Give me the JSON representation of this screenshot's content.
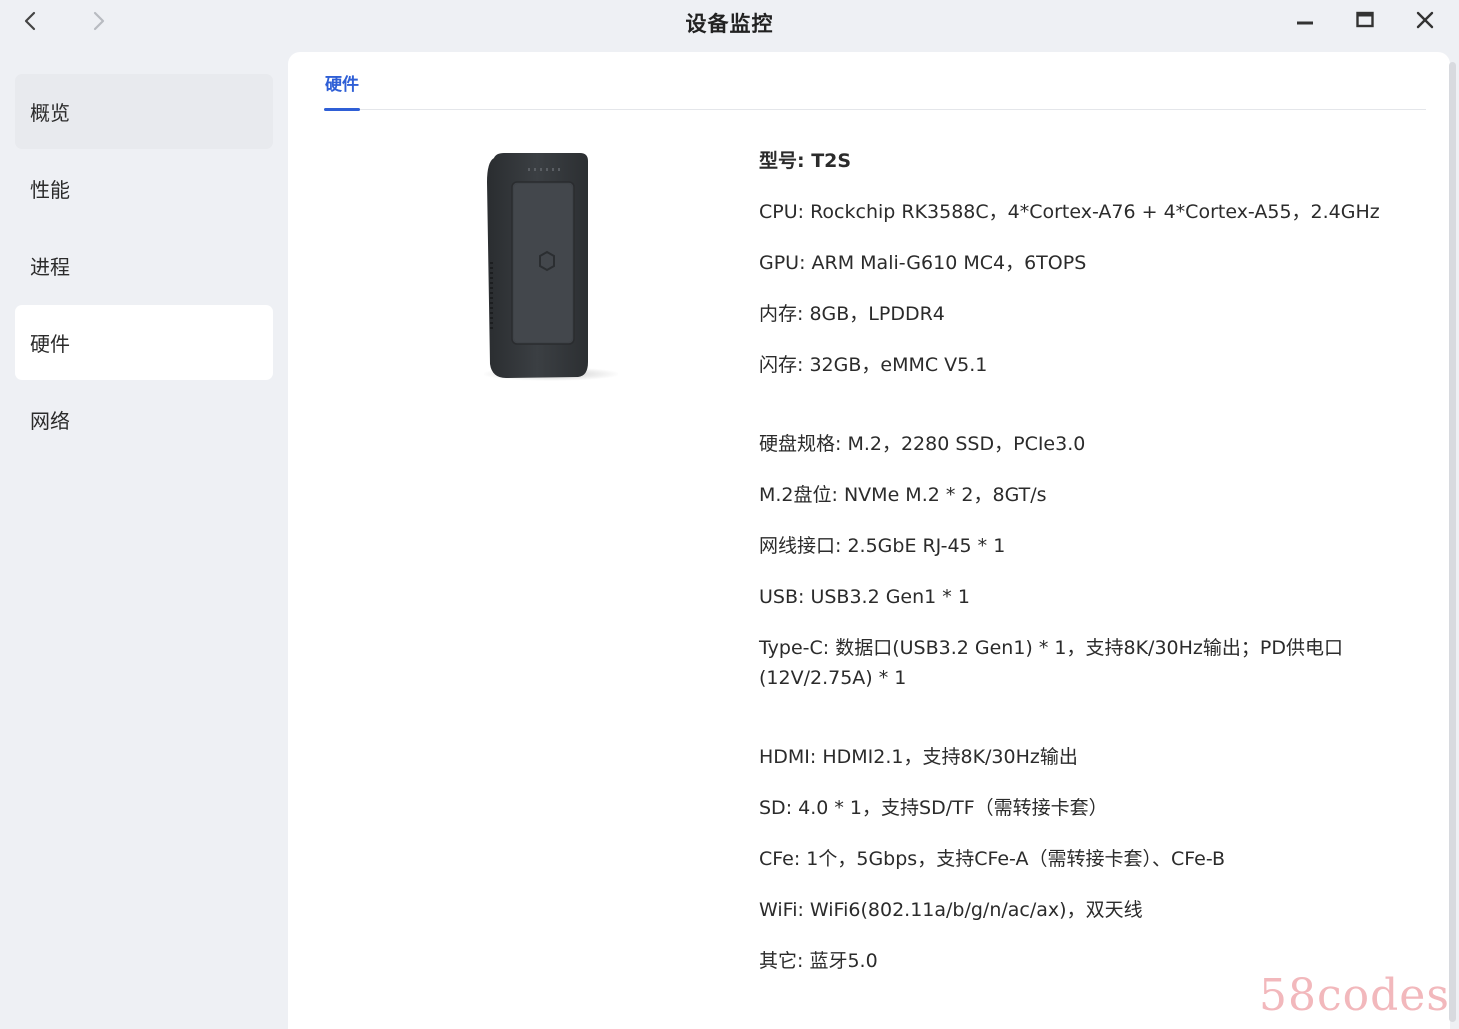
{
  "window": {
    "title": "设备监控"
  },
  "sidebar": {
    "items": [
      {
        "label": "概览"
      },
      {
        "label": "性能"
      },
      {
        "label": "进程"
      },
      {
        "label": "硬件"
      },
      {
        "label": "网络"
      }
    ],
    "active": "硬件"
  },
  "tabs": [
    {
      "label": "硬件"
    }
  ],
  "specs": [
    "型号: T2S",
    "CPU: Rockchip RK3588C，4*Cortex-A76 + 4*Cortex-A55，2.4GHz",
    "GPU: ARM Mali-G610 MC4，6TOPS",
    "内存: 8GB，LPDDR4",
    "闪存: 32GB，eMMC V5.1",
    "硬盘规格: M.2，2280 SSD，PCIe3.0",
    "M.2盘位: NVMe M.2 * 2，8GT/s",
    "网线接口: 2.5GbE RJ-45 * 1",
    "USB: USB3.2 Gen1 * 1",
    "Type-C: 数据口(USB3.2 Gen1) * 1，支持8K/30Hz输出；PD供电口(12V/2.75A) * 1",
    "HDMI: HDMI2.1，支持8K/30Hz输出",
    "SD: 4.0 * 1，支持SD/TF（需转接卡套）",
    "CFe: 1个，5Gbps，支持CFe-A（需转接卡套）、CFe-B",
    "WiFi: WiFi6(802.11a/b/g/n/ac/ax)，双天线",
    "其它: 蓝牙5.0"
  ],
  "watermark": "58codes",
  "icons": {
    "back": "chevron-left-icon",
    "forward": "chevron-right-icon",
    "minimize": "minimize-icon",
    "maximize": "maximize-icon",
    "close": "close-icon"
  },
  "colors": {
    "accent": "#2f5fd6",
    "background": "#eef0f4",
    "panel": "#ffffff"
  }
}
